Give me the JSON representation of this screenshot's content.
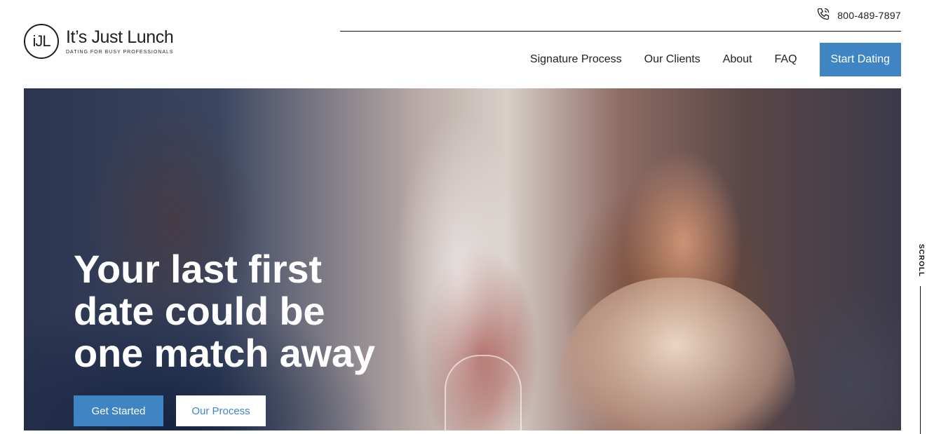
{
  "header": {
    "phone": "800-489-7897",
    "logo": {
      "mark": "iJL",
      "name": "It’s Just Lunch",
      "tagline": "DATING FOR BUSY PROFESSIONALS"
    },
    "nav": {
      "items": [
        {
          "label": "Signature Process"
        },
        {
          "label": "Our Clients"
        },
        {
          "label": "About"
        },
        {
          "label": "FAQ"
        }
      ],
      "cta": "Start Dating"
    }
  },
  "hero": {
    "title_lines": [
      "Your last first",
      "date could be",
      "one match away"
    ],
    "primary_button": "Get Started",
    "secondary_button": "Our Process"
  },
  "scroll_indicator": "SCROLL",
  "colors": {
    "accent": "#3f85c4",
    "text_dark": "#222222",
    "white": "#ffffff"
  },
  "icons": {
    "phone": "phone-icon"
  }
}
